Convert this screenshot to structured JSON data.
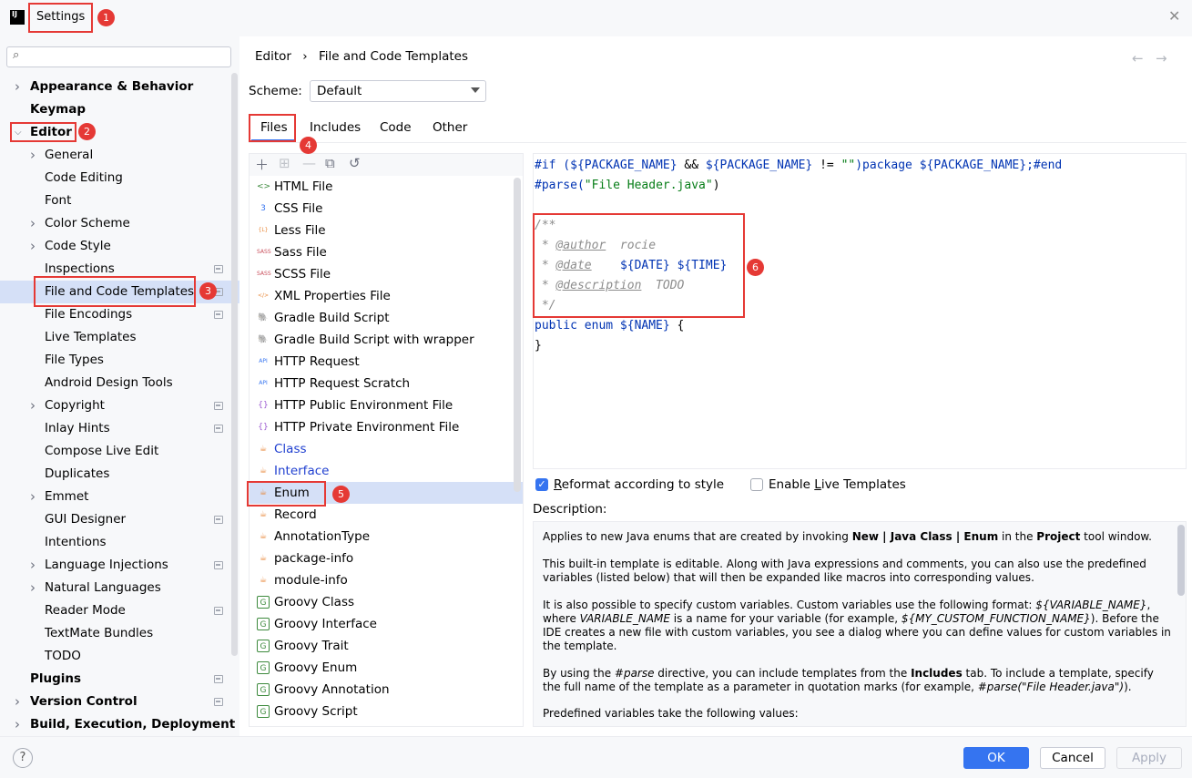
{
  "window": {
    "title": "Settings",
    "app_icon_text": "IJ"
  },
  "sidebar": {
    "items": [
      {
        "label": "Appearance & Behavior",
        "level": 0,
        "bold": true,
        "arrow": "right",
        "mark": false
      },
      {
        "label": "Keymap",
        "level": 0,
        "bold": true,
        "arrow": "",
        "mark": false
      },
      {
        "label": "Editor",
        "level": 0,
        "bold": true,
        "arrow": "down",
        "mark": false
      },
      {
        "label": "General",
        "level": 1,
        "bold": false,
        "arrow": "right",
        "mark": false
      },
      {
        "label": "Code Editing",
        "level": 1,
        "bold": false,
        "arrow": "",
        "mark": false
      },
      {
        "label": "Font",
        "level": 1,
        "bold": false,
        "arrow": "",
        "mark": false
      },
      {
        "label": "Color Scheme",
        "level": 1,
        "bold": false,
        "arrow": "right",
        "mark": false
      },
      {
        "label": "Code Style",
        "level": 1,
        "bold": false,
        "arrow": "right",
        "mark": false
      },
      {
        "label": "Inspections",
        "level": 1,
        "bold": false,
        "arrow": "",
        "mark": true
      },
      {
        "label": "File and Code Templates",
        "level": 1,
        "bold": false,
        "arrow": "",
        "mark": true
      },
      {
        "label": "File Encodings",
        "level": 1,
        "bold": false,
        "arrow": "",
        "mark": true
      },
      {
        "label": "Live Templates",
        "level": 1,
        "bold": false,
        "arrow": "",
        "mark": false
      },
      {
        "label": "File Types",
        "level": 1,
        "bold": false,
        "arrow": "",
        "mark": false
      },
      {
        "label": "Android Design Tools",
        "level": 1,
        "bold": false,
        "arrow": "",
        "mark": false
      },
      {
        "label": "Copyright",
        "level": 1,
        "bold": false,
        "arrow": "right",
        "mark": true
      },
      {
        "label": "Inlay Hints",
        "level": 1,
        "bold": false,
        "arrow": "",
        "mark": true
      },
      {
        "label": "Compose Live Edit",
        "level": 1,
        "bold": false,
        "arrow": "",
        "mark": false
      },
      {
        "label": "Duplicates",
        "level": 1,
        "bold": false,
        "arrow": "",
        "mark": false
      },
      {
        "label": "Emmet",
        "level": 1,
        "bold": false,
        "arrow": "right",
        "mark": false
      },
      {
        "label": "GUI Designer",
        "level": 1,
        "bold": false,
        "arrow": "",
        "mark": true
      },
      {
        "label": "Intentions",
        "level": 1,
        "bold": false,
        "arrow": "",
        "mark": false
      },
      {
        "label": "Language Injections",
        "level": 1,
        "bold": false,
        "arrow": "right",
        "mark": true
      },
      {
        "label": "Natural Languages",
        "level": 1,
        "bold": false,
        "arrow": "right",
        "mark": false
      },
      {
        "label": "Reader Mode",
        "level": 1,
        "bold": false,
        "arrow": "",
        "mark": true
      },
      {
        "label": "TextMate Bundles",
        "level": 1,
        "bold": false,
        "arrow": "",
        "mark": false
      },
      {
        "label": "TODO",
        "level": 1,
        "bold": false,
        "arrow": "",
        "mark": false
      },
      {
        "label": "Plugins",
        "level": 0,
        "bold": true,
        "arrow": "",
        "mark": true
      },
      {
        "label": "Version Control",
        "level": 0,
        "bold": true,
        "arrow": "right",
        "mark": true
      },
      {
        "label": "Build, Execution, Deployment",
        "level": 0,
        "bold": true,
        "arrow": "right",
        "mark": false
      }
    ]
  },
  "breadcrumb": {
    "parent": "Editor",
    "separator": "›",
    "current": "File and Code Templates"
  },
  "scheme": {
    "label": "Scheme:",
    "value": "Default"
  },
  "tabs": [
    "Files",
    "Includes",
    "Code",
    "Other"
  ],
  "templates": [
    {
      "label": "HTML File",
      "icon": "html-icon",
      "glyph": "<>",
      "color": "#3d8a3d",
      "link": false
    },
    {
      "label": "CSS File",
      "icon": "css-icon",
      "glyph": "3",
      "color": "#3574f0",
      "link": false
    },
    {
      "label": "Less File",
      "icon": "less-icon",
      "glyph": "{L}",
      "color": "#e8883a",
      "link": false
    },
    {
      "label": "Sass File",
      "icon": "sass-icon",
      "glyph": "SASS",
      "color": "#c94f5c",
      "link": false
    },
    {
      "label": "SCSS File",
      "icon": "scss-icon",
      "glyph": "SASS",
      "color": "#c94f5c",
      "link": false
    },
    {
      "label": "XML Properties File",
      "icon": "xml-icon",
      "glyph": "</>",
      "color": "#e8883a",
      "link": false
    },
    {
      "label": "Gradle Build Script",
      "icon": "gradle-icon",
      "glyph": "🐘",
      "color": "#6c707e",
      "link": false
    },
    {
      "label": "Gradle Build Script with wrapper",
      "icon": "gradle-icon",
      "glyph": "🐘",
      "color": "#6c707e",
      "link": false
    },
    {
      "label": "HTTP Request",
      "icon": "api-icon",
      "glyph": "API",
      "color": "#3574f0",
      "link": false
    },
    {
      "label": "HTTP Request Scratch",
      "icon": "api-icon",
      "glyph": "API",
      "color": "#3574f0",
      "link": false
    },
    {
      "label": "HTTP Public Environment File",
      "icon": "braces-icon",
      "glyph": "{}",
      "color": "#9b59d0",
      "link": false
    },
    {
      "label": "HTTP Private Environment File",
      "icon": "braces-icon",
      "glyph": "{}",
      "color": "#9b59d0",
      "link": false
    },
    {
      "label": "Class",
      "icon": "java-icon",
      "glyph": "☕",
      "color": "#e8883a",
      "link": true
    },
    {
      "label": "Interface",
      "icon": "java-icon",
      "glyph": "☕",
      "color": "#e8883a",
      "link": true
    },
    {
      "label": "Enum",
      "icon": "java-icon",
      "glyph": "☕",
      "color": "#e8883a",
      "link": false
    },
    {
      "label": "Record",
      "icon": "java-icon",
      "glyph": "☕",
      "color": "#e8883a",
      "link": false
    },
    {
      "label": "AnnotationType",
      "icon": "java-icon",
      "glyph": "☕",
      "color": "#e8883a",
      "link": false
    },
    {
      "label": "package-info",
      "icon": "java-icon",
      "glyph": "☕",
      "color": "#e8883a",
      "link": false
    },
    {
      "label": "module-info",
      "icon": "java-icon",
      "glyph": "☕",
      "color": "#e8883a",
      "link": false
    },
    {
      "label": "Groovy Class",
      "icon": "groovy-icon",
      "glyph": "G",
      "color": "#3d8a3d",
      "link": false
    },
    {
      "label": "Groovy Interface",
      "icon": "groovy-icon",
      "glyph": "G",
      "color": "#3d8a3d",
      "link": false
    },
    {
      "label": "Groovy Trait",
      "icon": "groovy-icon",
      "glyph": "G",
      "color": "#3d8a3d",
      "link": false
    },
    {
      "label": "Groovy Enum",
      "icon": "groovy-icon",
      "glyph": "G",
      "color": "#3d8a3d",
      "link": false
    },
    {
      "label": "Groovy Annotation",
      "icon": "groovy-icon",
      "glyph": "G",
      "color": "#3d8a3d",
      "link": false
    },
    {
      "label": "Groovy Script",
      "icon": "groovy-icon",
      "glyph": "G",
      "color": "#3d8a3d",
      "link": false
    }
  ],
  "editor": {
    "line1": [
      "#if (",
      "${PACKAGE_NAME}",
      " && ",
      "${PACKAGE_NAME}",
      " != ",
      "\"\"",
      ")package ",
      "${PACKAGE_NAME}",
      ";#end"
    ],
    "line2": [
      "#parse(",
      "\"File Header.java\"",
      ")"
    ],
    "line4": "/**",
    "line5": [
      " * ",
      "@author",
      "  rocie"
    ],
    "line6": [
      " * ",
      "@date",
      "    ",
      "${DATE}",
      " ",
      "${TIME}"
    ],
    "line7": [
      " * ",
      "@description",
      "  TODO"
    ],
    "line8": " */",
    "line9": [
      "public enum ",
      "${NAME}",
      " {"
    ],
    "line10": "}"
  },
  "options": {
    "reformat_pre": "",
    "reformat_ul": "R",
    "reformat_post": "eformat according to style",
    "live_pre": "Enable ",
    "live_ul": "L",
    "live_post": "ive Templates"
  },
  "description": {
    "label": "Description:",
    "p1": [
      "Applies to new Java enums that are created by invoking ",
      "New | Java Class | Enum",
      " in the ",
      "Project",
      " tool window."
    ],
    "p2": "This built-in template is editable. Along with Java expressions and comments, you can also use the predefined variables (listed below) that will then be expanded like macros into corresponding values.",
    "p3": [
      "It is also possible to specify custom variables. Custom variables use the following format: ",
      "${VARIABLE_NAME}",
      ", where ",
      "VARIABLE_NAME",
      " is a name for your variable (for example, ",
      "${MY_CUSTOM_FUNCTION_NAME}",
      "). Before the IDE creates a new file with custom variables, you see a dialog where you can define values for custom variables in the template."
    ],
    "p4": [
      "By using the ",
      "#parse",
      " directive, you can include templates from the ",
      "Includes",
      " tab. To include a template, specify the full name of the template as a parameter in quotation marks (for example, ",
      "#parse(\"File Header.java\")",
      ")."
    ],
    "p5": "Predefined variables take the following values:"
  },
  "footer": {
    "help": "?",
    "ok": "OK",
    "cancel": "Cancel",
    "apply": "Apply"
  },
  "annotations": [
    "1",
    "2",
    "3",
    "4",
    "5",
    "6"
  ],
  "colors": {
    "accent": "#3574f0",
    "annotation": "#e53935",
    "selection": "#d5e0f7"
  }
}
